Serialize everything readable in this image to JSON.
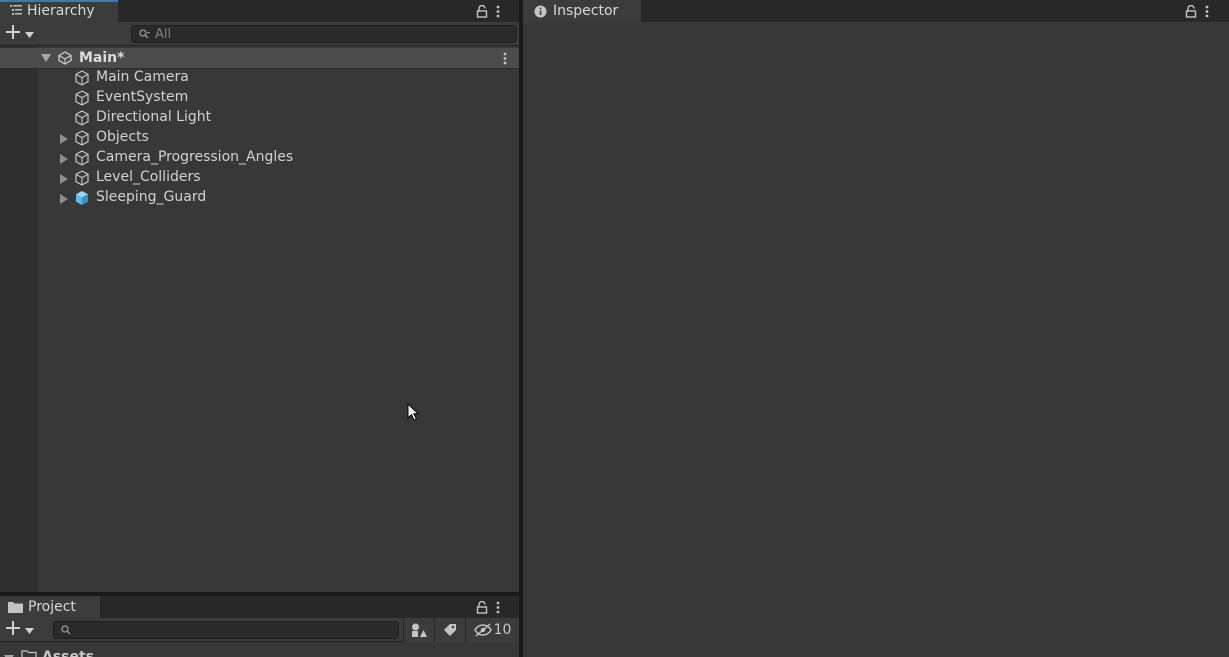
{
  "hierarchy": {
    "tab_label": "Hierarchy",
    "search_placeholder": "All",
    "scene_name": "Main*",
    "items": [
      {
        "label": "Main Camera",
        "has_children": false,
        "prefab": false
      },
      {
        "label": "EventSystem",
        "has_children": false,
        "prefab": false
      },
      {
        "label": "Directional Light",
        "has_children": false,
        "prefab": false
      },
      {
        "label": "Objects",
        "has_children": true,
        "prefab": false
      },
      {
        "label": "Camera_Progression_Angles",
        "has_children": true,
        "prefab": false
      },
      {
        "label": "Level_Colliders",
        "has_children": true,
        "prefab": false
      },
      {
        "label": "Sleeping_Guard",
        "has_children": true,
        "prefab": true
      }
    ]
  },
  "inspector": {
    "tab_label": "Inspector"
  },
  "project": {
    "tab_label": "Project",
    "search_placeholder": "",
    "hidden_count": "10",
    "root_folder": "Assets"
  },
  "colors": {
    "panel_bg": "#383838",
    "toolbar_bg": "#3c3c3c",
    "tab_highlight": "#3a79bb",
    "prefab_icon": "#5fb6e8"
  },
  "icons": [
    "hierarchy-list-icon",
    "lock-icon",
    "kebab-menu-icon",
    "plus-icon",
    "dropdown-arrow-icon",
    "search-icon",
    "unity-scene-icon",
    "gameobject-cube-icon",
    "prefab-cube-icon",
    "foldout-arrow-icon",
    "info-icon",
    "folder-icon",
    "filter-by-type-icon",
    "filter-by-label-icon",
    "hidden-packages-icon"
  ]
}
